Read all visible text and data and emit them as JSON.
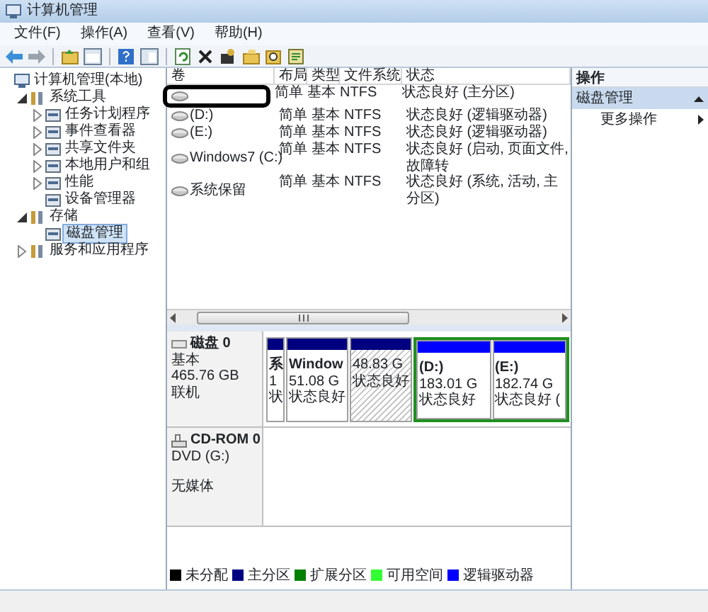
{
  "window": {
    "title": "计算机管理"
  },
  "menu": [
    "文件(F)",
    "操作(A)",
    "查看(V)",
    "帮助(H)"
  ],
  "tree": [
    {
      "label": "计算机管理(本地)",
      "expandable": false,
      "expanded": true,
      "selected": false,
      "children": [
        {
          "label": "系统工具",
          "expandable": true,
          "expanded": true,
          "selected": false,
          "children": [
            {
              "label": "任务计划程序",
              "expandable": true,
              "expanded": false,
              "selected": false
            },
            {
              "label": "事件查看器",
              "expandable": true,
              "expanded": false,
              "selected": false
            },
            {
              "label": "共享文件夹",
              "expandable": true,
              "expanded": false,
              "selected": false
            },
            {
              "label": "本地用户和组",
              "expandable": true,
              "expanded": false,
              "selected": false
            },
            {
              "label": "性能",
              "expandable": true,
              "expanded": false,
              "selected": false
            },
            {
              "label": "设备管理器",
              "expandable": false,
              "selected": false
            }
          ]
        },
        {
          "label": "存储",
          "expandable": true,
          "expanded": true,
          "selected": false,
          "children": [
            {
              "label": "磁盘管理",
              "expandable": false,
              "selected": true
            }
          ]
        },
        {
          "label": "服务和应用程序",
          "expandable": true,
          "expanded": false,
          "selected": false
        }
      ]
    }
  ],
  "volumes": {
    "columns": [
      "卷",
      "布局",
      "类型",
      "文件系统",
      "状态"
    ],
    "rows": [
      {
        "layout": "简单",
        "type": "基本",
        "file_system": "NTFS",
        "status": "状态良好 (主分区)",
        "circled": true
      },
      {
        "name": "(D:)",
        "layout": "简单",
        "type": "基本",
        "file_system": "NTFS",
        "status": "状态良好 (逻辑驱动器)",
        "circled": false
      },
      {
        "name": "(E:)",
        "layout": "简单",
        "type": "基本",
        "file_system": "NTFS",
        "status": "状态良好 (逻辑驱动器)",
        "circled": false
      },
      {
        "name": "Windows7 (C:)",
        "layout": "简单",
        "type": "基本",
        "file_system": "NTFS",
        "status": "状态良好 (启动, 页面文件, 故障转",
        "circled": false
      },
      {
        "name": "系统保留",
        "layout": "简单",
        "type": "基本",
        "file_system": "NTFS",
        "status": "状态良好 (系统, 活动, 主分区)",
        "circled": false
      }
    ]
  },
  "disks": [
    {
      "kind": "disk",
      "title": "磁盘 0",
      "lines": [
        "基本",
        "465.76 GB",
        "联机"
      ],
      "partitions": [
        {
          "kind": "primary",
          "selected": false,
          "lines": [
            "系",
            "1",
            "状"
          ]
        },
        {
          "kind": "primary",
          "selected": false,
          "lines": [
            "Window",
            "51.08 G",
            "状态良好"
          ]
        },
        {
          "kind": "primary",
          "selected": true,
          "lines": [
            "48.83 G",
            "状态良好"
          ]
        },
        {
          "kind": "extended",
          "selected": false,
          "children": [
            {
              "kind": "logical",
              "selected": false,
              "lines": [
                "(D:)",
                "183.01 G",
                "状态良好"
              ]
            },
            {
              "kind": "logical",
              "selected": false,
              "lines": [
                "(E:)",
                "182.74 G",
                "状态良好 ("
              ]
            }
          ]
        }
      ]
    },
    {
      "kind": "cdrom",
      "title": "CD-ROM 0",
      "lines": [
        "DVD (G:)",
        "无媒体"
      ]
    }
  ],
  "legend": [
    {
      "label": "未分配",
      "color": "#000000"
    },
    {
      "label": "主分区",
      "color": "#000080"
    },
    {
      "label": "扩展分区",
      "color": "#008000"
    },
    {
      "label": "可用空间",
      "color": "#33ff33"
    },
    {
      "label": "逻辑驱动器",
      "color": "#0000ff"
    }
  ],
  "actions": {
    "header": "操作",
    "sections": [
      {
        "title": "磁盘管理",
        "expanded": true,
        "items": [
          {
            "label": "更多操作"
          }
        ]
      }
    ]
  }
}
